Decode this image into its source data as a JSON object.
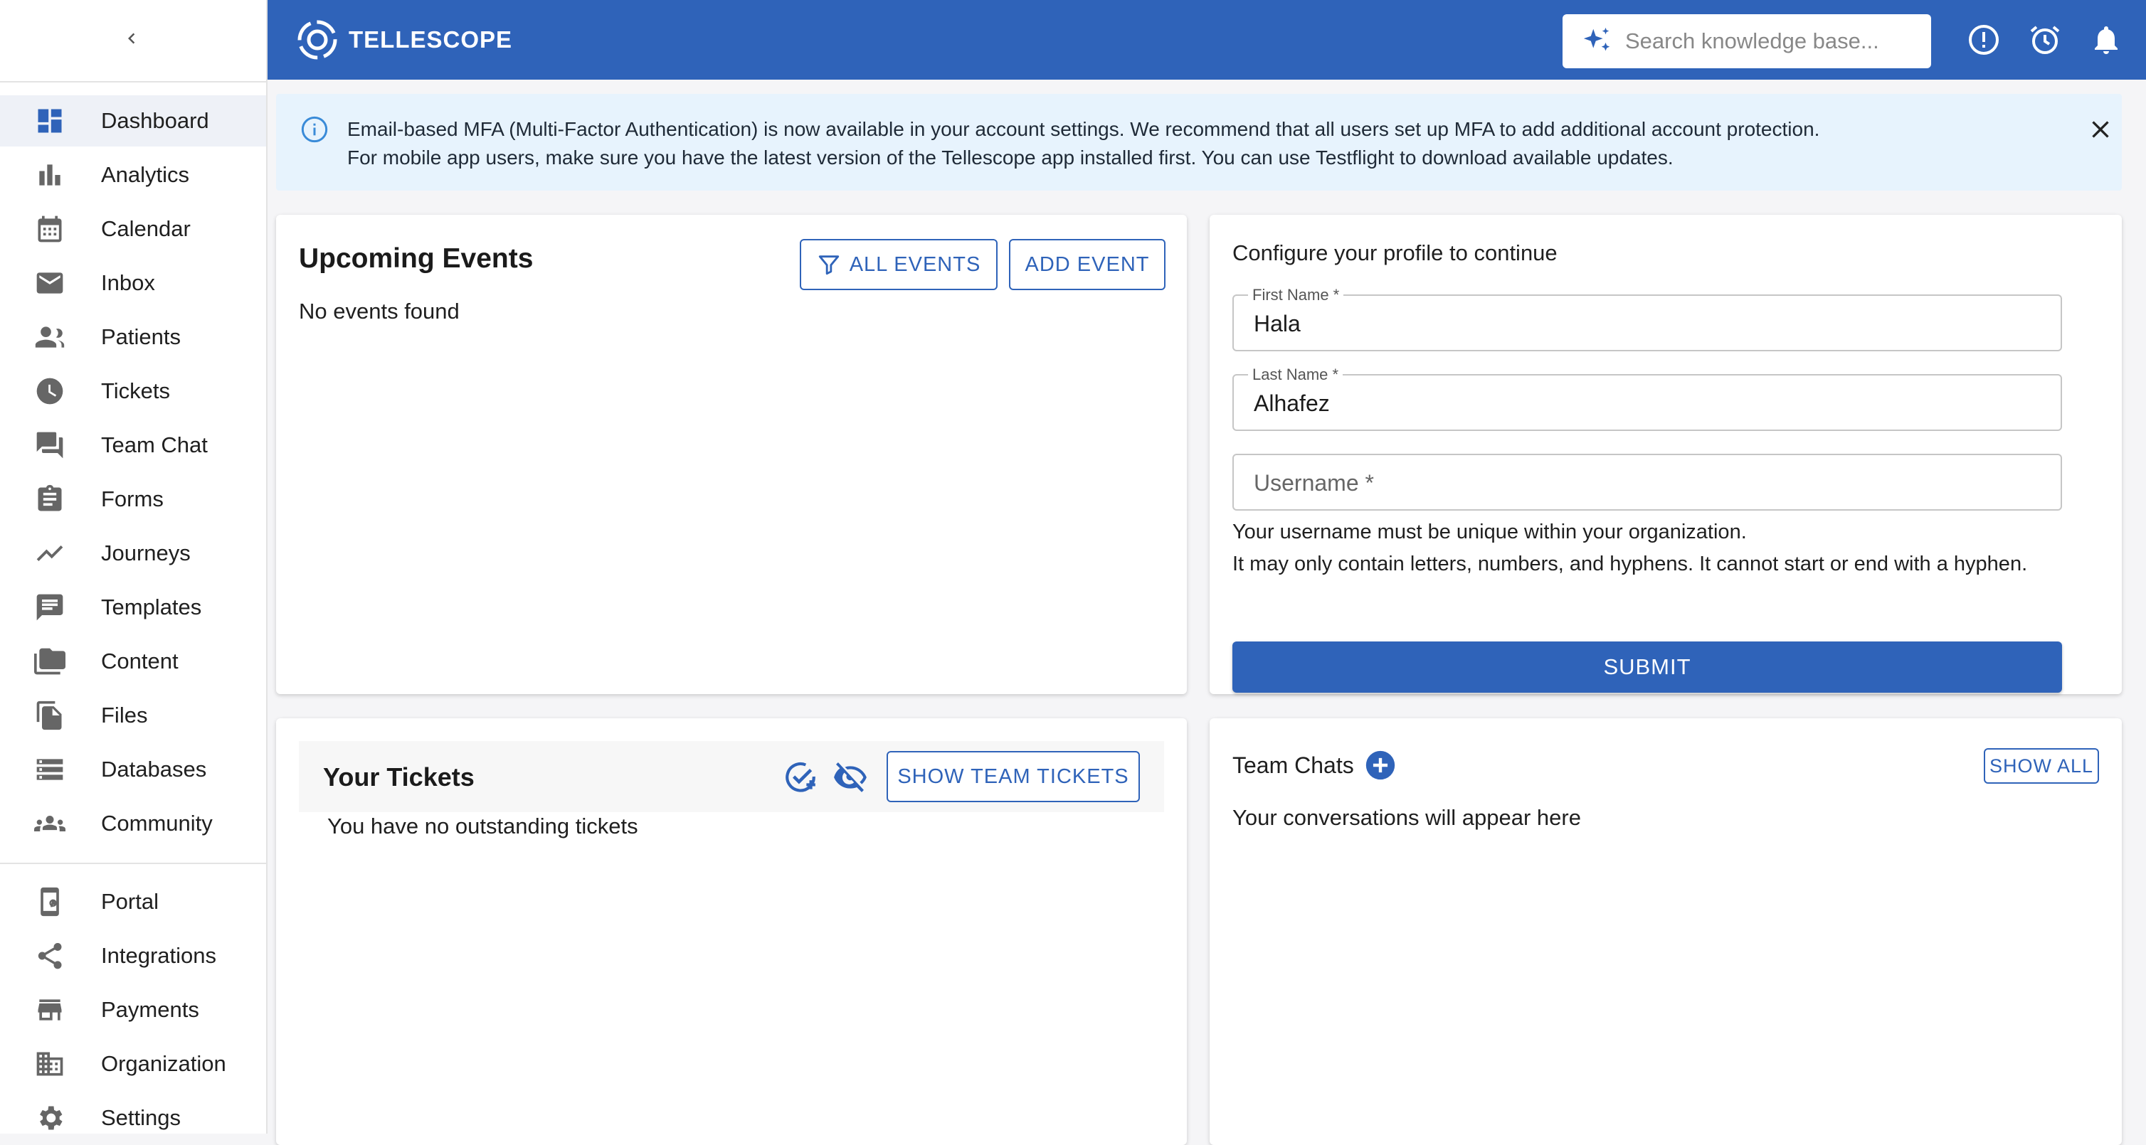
{
  "app": {
    "name": "TELLESCOPE"
  },
  "search": {
    "placeholder": "Search knowledge base..."
  },
  "sidebar": {
    "items": [
      {
        "label": "Dashboard",
        "icon": "dashboard-icon"
      },
      {
        "label": "Analytics",
        "icon": "analytics-icon"
      },
      {
        "label": "Calendar",
        "icon": "calendar-icon"
      },
      {
        "label": "Inbox",
        "icon": "inbox-icon"
      },
      {
        "label": "Patients",
        "icon": "patients-icon"
      },
      {
        "label": "Tickets",
        "icon": "tickets-icon"
      },
      {
        "label": "Team Chat",
        "icon": "team-chat-icon"
      },
      {
        "label": "Forms",
        "icon": "forms-icon"
      },
      {
        "label": "Journeys",
        "icon": "journeys-icon"
      },
      {
        "label": "Templates",
        "icon": "templates-icon"
      },
      {
        "label": "Content",
        "icon": "content-icon"
      },
      {
        "label": "Files",
        "icon": "files-icon"
      },
      {
        "label": "Databases",
        "icon": "databases-icon"
      },
      {
        "label": "Community",
        "icon": "community-icon"
      },
      {
        "label": "Portal",
        "icon": "portal-icon"
      },
      {
        "label": "Integrations",
        "icon": "integrations-icon"
      },
      {
        "label": "Payments",
        "icon": "payments-icon"
      },
      {
        "label": "Organization",
        "icon": "organization-icon"
      },
      {
        "label": "Settings",
        "icon": "settings-icon"
      }
    ]
  },
  "banner": {
    "line1": "Email-based MFA (Multi-Factor Authentication) is now available in your account settings. We recommend that all users set up MFA to add additional account protection.",
    "line2": "For mobile app users, make sure you have the latest version of the Tellescope app installed first. You can use Testflight to download available updates."
  },
  "events": {
    "title": "Upcoming Events",
    "all_events_label": "ALL EVENTS",
    "add_event_label": "ADD EVENT",
    "empty": "No events found"
  },
  "profile": {
    "title": "Configure your profile to continue",
    "first_name_label": "First Name *",
    "first_name_value": "Hala",
    "last_name_label": "Last Name *",
    "last_name_value": "Alhafez",
    "username_placeholder": "Username *",
    "helper_line1": "Your username must be unique within your organization.",
    "helper_line2": "It may only contain letters, numbers, and hyphens. It cannot start or end with a hyphen.",
    "submit_label": "SUBMIT"
  },
  "tickets": {
    "title": "Your Tickets",
    "show_team_label": "SHOW TEAM TICKETS",
    "empty": "You have no outstanding tickets"
  },
  "team_chats": {
    "title": "Team Chats",
    "show_all_label": "SHOW ALL",
    "empty": "Your conversations will appear here"
  },
  "colors": {
    "brand": "#2f63b9",
    "banner_bg": "#e7f3fd",
    "active_nav_bg": "#eef1f7"
  }
}
